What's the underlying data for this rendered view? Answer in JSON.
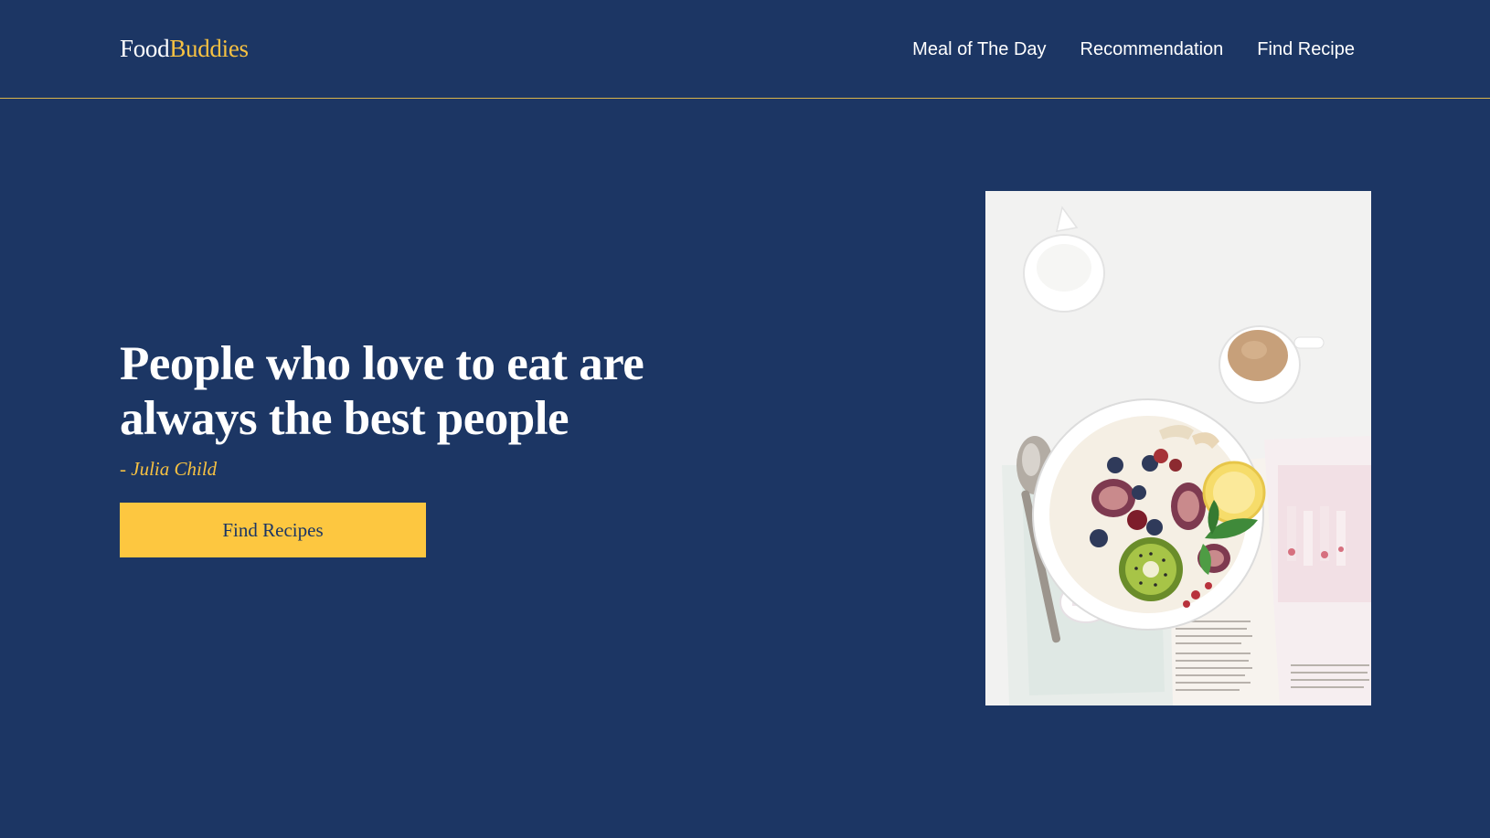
{
  "header": {
    "logo_part1": "Food",
    "logo_part2": "Buddies",
    "nav": [
      {
        "label": "Meal of The Day"
      },
      {
        "label": "Recommendation"
      },
      {
        "label": "Find Recipe"
      }
    ]
  },
  "hero": {
    "headline_line1": "People who love to eat are",
    "headline_line2": "always the best people",
    "author": "- Julia Child",
    "cta_label": "Find Recipes"
  },
  "colors": {
    "background": "#1c3664",
    "accent": "#f6c142",
    "button": "#fdc740",
    "text": "#ffffff"
  },
  "icons": {
    "hero_image": "breakfast-bowl-photo"
  }
}
